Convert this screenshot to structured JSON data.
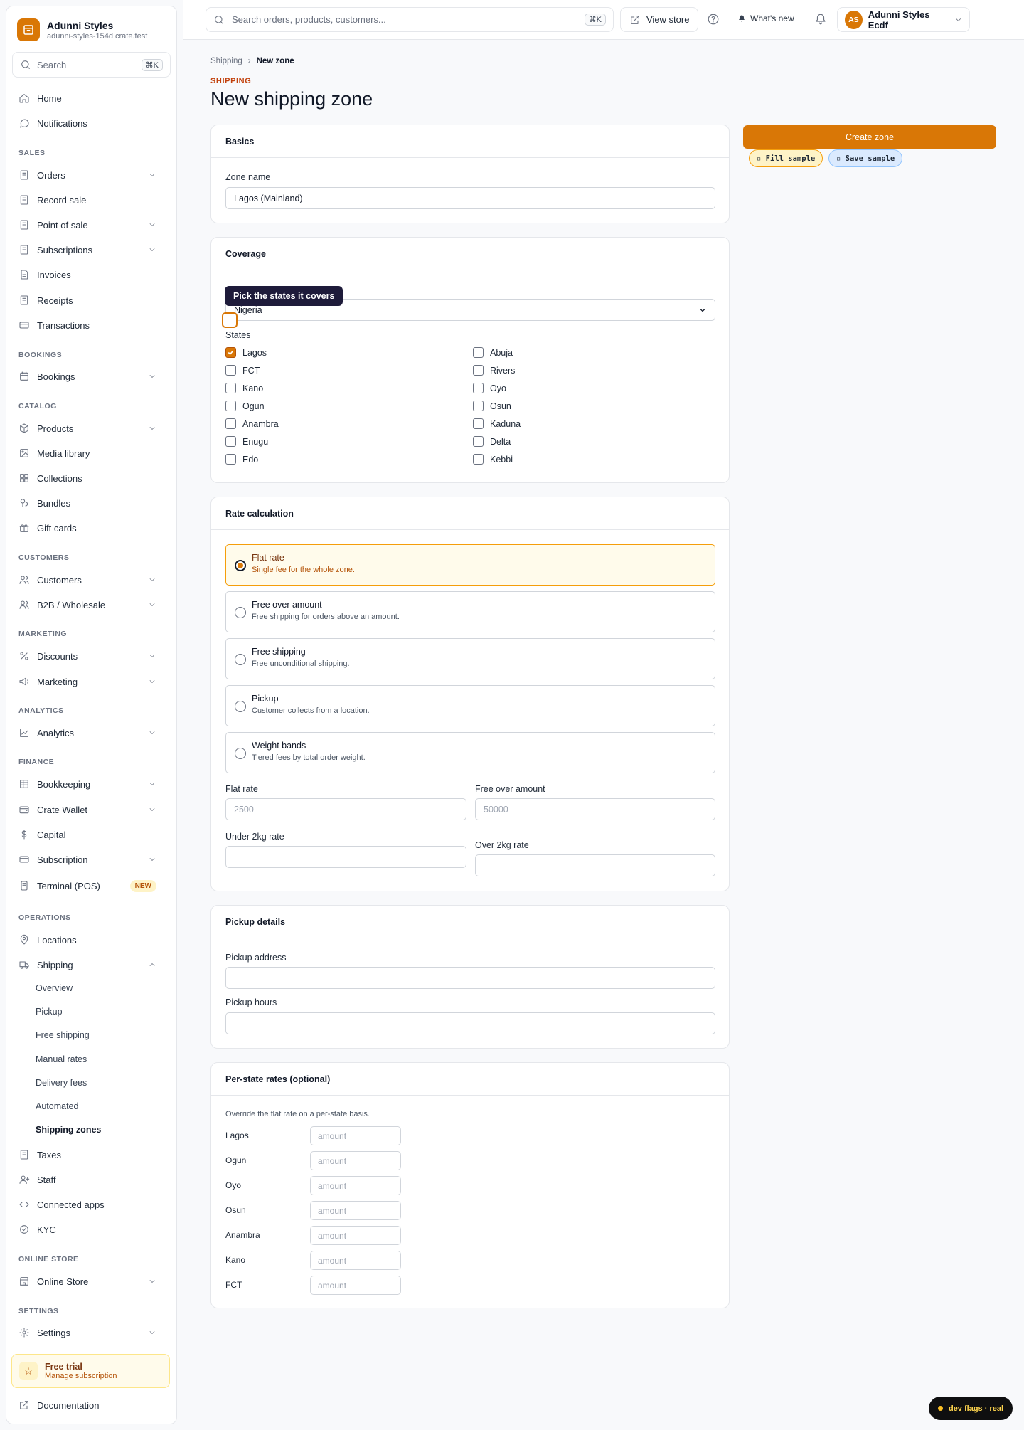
{
  "brand": {
    "name": "Adunni Styles",
    "domain": "adunni-styles-154d.crate.test"
  },
  "sidebar": {
    "search_placeholder": "Search",
    "search_shortcut": "⌘K",
    "home": "Home",
    "notifications": "Notifications",
    "sections": {
      "sales": "SALES",
      "bookings": "BOOKINGS",
      "catalog": "CATALOG",
      "customers": "CUSTOMERS",
      "marketing": "MARKETING",
      "analytics": "ANALYTICS",
      "finance": "FINANCE",
      "operations": "OPERATIONS",
      "online_store": "ONLINE STORE",
      "settings": "SETTINGS"
    },
    "items": {
      "orders": "Orders",
      "record_sale": "Record sale",
      "pos": "Point of sale",
      "subscriptions": "Subscriptions",
      "invoices": "Invoices",
      "receipts": "Receipts",
      "transactions": "Transactions",
      "bookings": "Bookings",
      "products": "Products",
      "media": "Media library",
      "collections": "Collections",
      "bundles": "Bundles",
      "gift_cards": "Gift cards",
      "customers": "Customers",
      "b2b": "B2B / Wholesale",
      "discounts": "Discounts",
      "marketing": "Marketing",
      "analytics": "Analytics",
      "bookkeeping": "Bookkeeping",
      "wallet": "Crate Wallet",
      "capital": "Capital",
      "subscription": "Subscription",
      "terminal": "Terminal (POS)",
      "locations": "Locations",
      "shipping": "Shipping",
      "taxes": "Taxes",
      "staff": "Staff",
      "connected_apps": "Connected apps",
      "kyc": "KYC",
      "online_store": "Online Store",
      "settings": "Settings"
    },
    "terminal_badge": "NEW",
    "shipping_sub": [
      "Overview",
      "Pickup",
      "Free shipping",
      "Manual rates",
      "Delivery fees",
      "Automated",
      "Shipping zones"
    ],
    "trial": {
      "title": "Free trial",
      "subtitle": "Manage subscription"
    },
    "documentation": "Documentation"
  },
  "topbar": {
    "search_placeholder": "Search orders, products, customers...",
    "search_shortcut": "⌘K",
    "view_store": "View store",
    "whats_new": "What's new",
    "account_initials": "AS",
    "account_name": "Adunni Styles Ecdf"
  },
  "breadcrumb": {
    "parent": "Shipping",
    "separator": "›",
    "current": "New zone"
  },
  "eyebrow": "SHIPPING",
  "page_title": "New shipping zone",
  "basics": {
    "title": "Basics",
    "zone_name_label": "Zone name",
    "zone_name_value": "Lagos (Mainland)"
  },
  "coverage": {
    "title": "Coverage",
    "tooltip": "Pick the states it covers",
    "country": "Nigeria",
    "states_label": "States",
    "states_left": [
      {
        "name": "Lagos",
        "checked": true
      },
      {
        "name": "FCT",
        "checked": false
      },
      {
        "name": "Kano",
        "checked": false
      },
      {
        "name": "Ogun",
        "checked": false
      },
      {
        "name": "Anambra",
        "checked": false
      },
      {
        "name": "Enugu",
        "checked": false
      },
      {
        "name": "Edo",
        "checked": false
      }
    ],
    "states_right": [
      {
        "name": "Abuja",
        "checked": false
      },
      {
        "name": "Rivers",
        "checked": false
      },
      {
        "name": "Oyo",
        "checked": false
      },
      {
        "name": "Osun",
        "checked": false
      },
      {
        "name": "Kaduna",
        "checked": false
      },
      {
        "name": "Delta",
        "checked": false
      },
      {
        "name": "Kebbi",
        "checked": false
      }
    ]
  },
  "rate": {
    "title": "Rate calculation",
    "options": [
      {
        "title": "Flat rate",
        "desc": "Single fee for the whole zone.",
        "selected": true
      },
      {
        "title": "Free over amount",
        "desc": "Free shipping for orders above an amount.",
        "selected": false
      },
      {
        "title": "Free shipping",
        "desc": "Free unconditional shipping.",
        "selected": false
      },
      {
        "title": "Pickup",
        "desc": "Customer collects from a location.",
        "selected": false
      },
      {
        "title": "Weight bands",
        "desc": "Tiered fees by total order weight.",
        "selected": false
      }
    ],
    "flat_label": "Flat rate",
    "flat_placeholder": "2500",
    "free_over_label": "Free over amount",
    "free_over_placeholder": "50000",
    "under2_label": "Under 2kg rate",
    "over2_label": "Over 2kg rate"
  },
  "pickup": {
    "title": "Pickup details",
    "address_label": "Pickup address",
    "hours_label": "Pickup hours"
  },
  "per_state": {
    "title": "Per-state rates (optional)",
    "help": "Override the flat rate on a per-state basis.",
    "placeholder": "amount",
    "states": [
      "Lagos",
      "Ogun",
      "Oyo",
      "Osun",
      "Anambra",
      "Kano",
      "FCT"
    ]
  },
  "actions": {
    "create": "Create zone",
    "fill_sample": "▫ Fill sample",
    "save_sample": "▫ Save sample"
  },
  "dev_flags": "dev flags · real",
  "colors": {
    "accent": "#d97706",
    "tooltip": "#1e1b3a"
  }
}
